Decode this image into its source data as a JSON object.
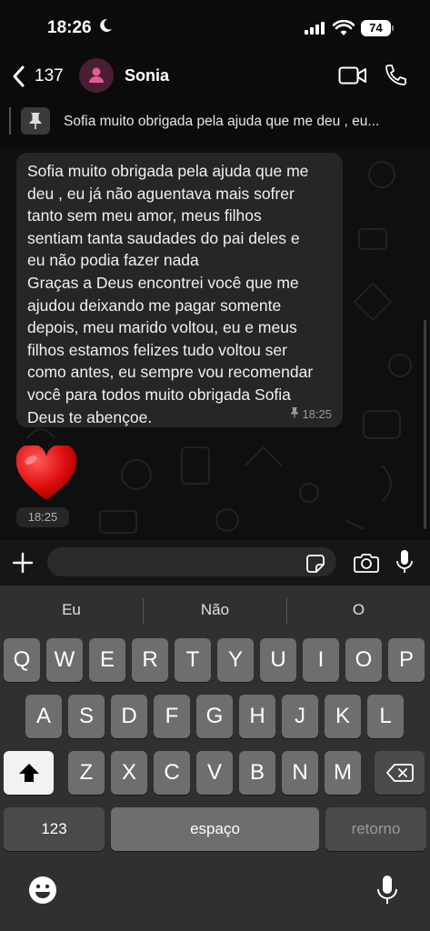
{
  "status_bar": {
    "time": "18:26",
    "battery": "74"
  },
  "header": {
    "back_count": "137",
    "contact_name": "Sonia"
  },
  "pinned": {
    "text": "Sofia muito obrigada pela ajuda que me deu , eu..."
  },
  "message": {
    "lines": [
      "Sofia muito obrigada pela ajuda que me",
      "deu , eu já não aguentava mais sofrer",
      "tanto sem meu amor, meus filhos",
      "sentiam tanta saudades do pai deles e",
      "eu não podia fazer nada",
      "Graças a Deus encontrei você que me",
      "ajudou deixando me pagar somente",
      "depois, meu marido voltou, eu e meus",
      "filhos estamos felizes tudo voltou ser",
      "como antes, eu sempre vou recomendar",
      "você para todos muito obrigada Sofia",
      "Deus te abençoe."
    ],
    "time": "18:25"
  },
  "heart_message": {
    "time": "18:25"
  },
  "keyboard": {
    "suggestions": [
      "Eu",
      "Não",
      "O"
    ],
    "row1": [
      "Q",
      "W",
      "E",
      "R",
      "T",
      "Y",
      "U",
      "I",
      "O",
      "P"
    ],
    "row2": [
      "A",
      "S",
      "D",
      "F",
      "G",
      "H",
      "J",
      "K",
      "L"
    ],
    "row3": [
      "Z",
      "X",
      "C",
      "V",
      "B",
      "N",
      "M"
    ],
    "numbers_key": "123",
    "space_key": "espaço",
    "return_key": "retorno"
  },
  "colors": {
    "avatar_bg": "#4a1f33",
    "avatar_icon": "#e85a9a",
    "bubble": "#262628"
  }
}
